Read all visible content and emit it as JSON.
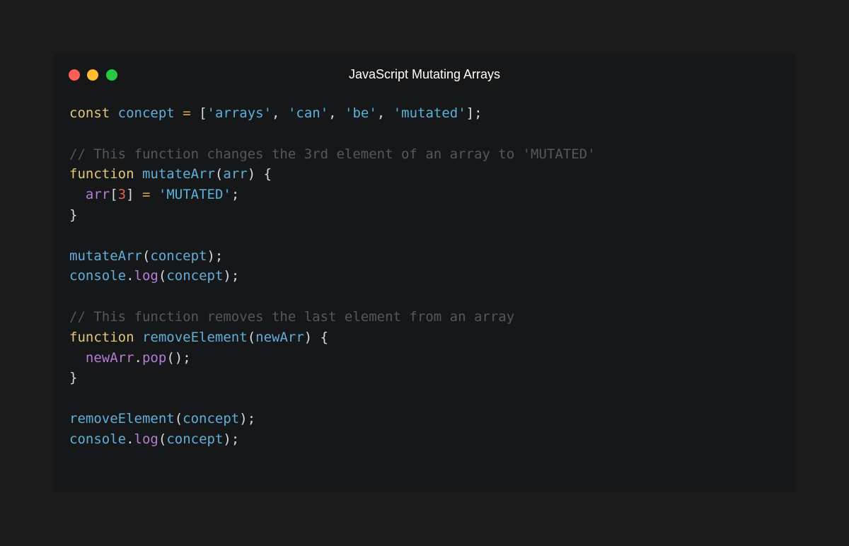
{
  "window": {
    "title": "JavaScript Mutating Arrays",
    "controls": {
      "close_color": "#ff5f57",
      "minimize_color": "#febc2e",
      "zoom_color": "#28c840"
    }
  },
  "code": {
    "lines": [
      [
        {
          "t": "const",
          "c": "kw"
        },
        {
          "t": " ",
          "c": "punc"
        },
        {
          "t": "concept",
          "c": "fn"
        },
        {
          "t": " ",
          "c": "punc"
        },
        {
          "t": "=",
          "c": "op"
        },
        {
          "t": " [",
          "c": "punc"
        },
        {
          "t": "'arrays'",
          "c": "str"
        },
        {
          "t": ", ",
          "c": "punc"
        },
        {
          "t": "'can'",
          "c": "str"
        },
        {
          "t": ", ",
          "c": "punc"
        },
        {
          "t": "'be'",
          "c": "str"
        },
        {
          "t": ", ",
          "c": "punc"
        },
        {
          "t": "'mutated'",
          "c": "str"
        },
        {
          "t": "];",
          "c": "punc"
        }
      ],
      [],
      [
        {
          "t": "// This function changes the 3rd element of an array to 'MUTATED'",
          "c": "cmt"
        }
      ],
      [
        {
          "t": "function",
          "c": "kw"
        },
        {
          "t": " ",
          "c": "punc"
        },
        {
          "t": "mutateArr",
          "c": "fn"
        },
        {
          "t": "(",
          "c": "punc"
        },
        {
          "t": "arr",
          "c": "fn"
        },
        {
          "t": ") {",
          "c": "punc"
        }
      ],
      [
        {
          "t": "  ",
          "c": "punc"
        },
        {
          "t": "arr",
          "c": "prop"
        },
        {
          "t": "[",
          "c": "punc"
        },
        {
          "t": "3",
          "c": "num"
        },
        {
          "t": "] ",
          "c": "punc"
        },
        {
          "t": "=",
          "c": "op"
        },
        {
          "t": " ",
          "c": "punc"
        },
        {
          "t": "'MUTATED'",
          "c": "str"
        },
        {
          "t": ";",
          "c": "punc"
        }
      ],
      [
        {
          "t": "}",
          "c": "punc"
        }
      ],
      [],
      [
        {
          "t": "mutateArr",
          "c": "fn"
        },
        {
          "t": "(",
          "c": "punc"
        },
        {
          "t": "concept",
          "c": "fn"
        },
        {
          "t": ");",
          "c": "punc"
        }
      ],
      [
        {
          "t": "console",
          "c": "fn"
        },
        {
          "t": ".",
          "c": "punc"
        },
        {
          "t": "log",
          "c": "prop"
        },
        {
          "t": "(",
          "c": "punc"
        },
        {
          "t": "concept",
          "c": "fn"
        },
        {
          "t": ");",
          "c": "punc"
        }
      ],
      [],
      [
        {
          "t": "// This function removes the last element from an array",
          "c": "cmt"
        }
      ],
      [
        {
          "t": "function",
          "c": "kw"
        },
        {
          "t": " ",
          "c": "punc"
        },
        {
          "t": "removeElement",
          "c": "fn"
        },
        {
          "t": "(",
          "c": "punc"
        },
        {
          "t": "newArr",
          "c": "fn"
        },
        {
          "t": ") {",
          "c": "punc"
        }
      ],
      [
        {
          "t": "  ",
          "c": "punc"
        },
        {
          "t": "newArr",
          "c": "prop"
        },
        {
          "t": ".",
          "c": "punc"
        },
        {
          "t": "pop",
          "c": "prop"
        },
        {
          "t": "();",
          "c": "punc"
        }
      ],
      [
        {
          "t": "}",
          "c": "punc"
        }
      ],
      [],
      [
        {
          "t": "removeElement",
          "c": "fn"
        },
        {
          "t": "(",
          "c": "punc"
        },
        {
          "t": "concept",
          "c": "fn"
        },
        {
          "t": ");",
          "c": "punc"
        }
      ],
      [
        {
          "t": "console",
          "c": "fn"
        },
        {
          "t": ".",
          "c": "punc"
        },
        {
          "t": "log",
          "c": "prop"
        },
        {
          "t": "(",
          "c": "punc"
        },
        {
          "t": "concept",
          "c": "fn"
        },
        {
          "t": ");",
          "c": "punc"
        }
      ]
    ]
  }
}
